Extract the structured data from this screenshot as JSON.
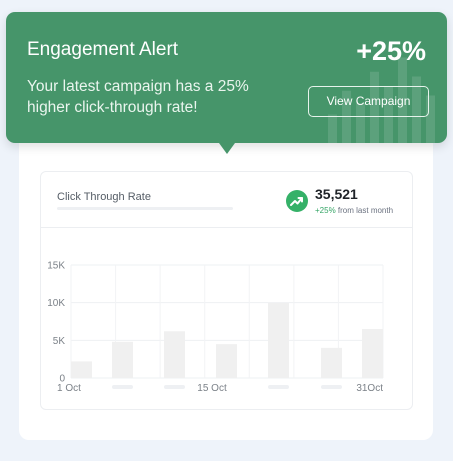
{
  "alert": {
    "title": "Engagement Alert",
    "message": "Your latest campaign has a 25% higher click-through rate!",
    "percentage": "+25%",
    "button_label": "View Campaign",
    "color": "#46956a",
    "decor_bar_levels": [
      0.3,
      0.55,
      0.42,
      0.75,
      0.6,
      0.9,
      0.7,
      0.5
    ]
  },
  "metric": {
    "label": "Click Through Rate",
    "value": "35,521",
    "change_pct": "+25%",
    "change_text": "from last month",
    "trend_icon": "trending-up-icon",
    "accent": "#35b168"
  },
  "chart_data": {
    "type": "bar",
    "title": "",
    "xlabel": "",
    "ylabel": "",
    "ylim": [
      0,
      15000
    ],
    "yticks": [
      0,
      5000,
      10000,
      15000
    ],
    "ytick_labels": [
      "0",
      "5K",
      "10K",
      "15K"
    ],
    "xtick_labels": [
      "1 Oct",
      "15 Oct",
      "31Oct"
    ],
    "grid": true,
    "values": [
      2200,
      4800,
      6200,
      4500,
      10000,
      4000,
      6500
    ],
    "bar_color": "#f0f0f0"
  }
}
